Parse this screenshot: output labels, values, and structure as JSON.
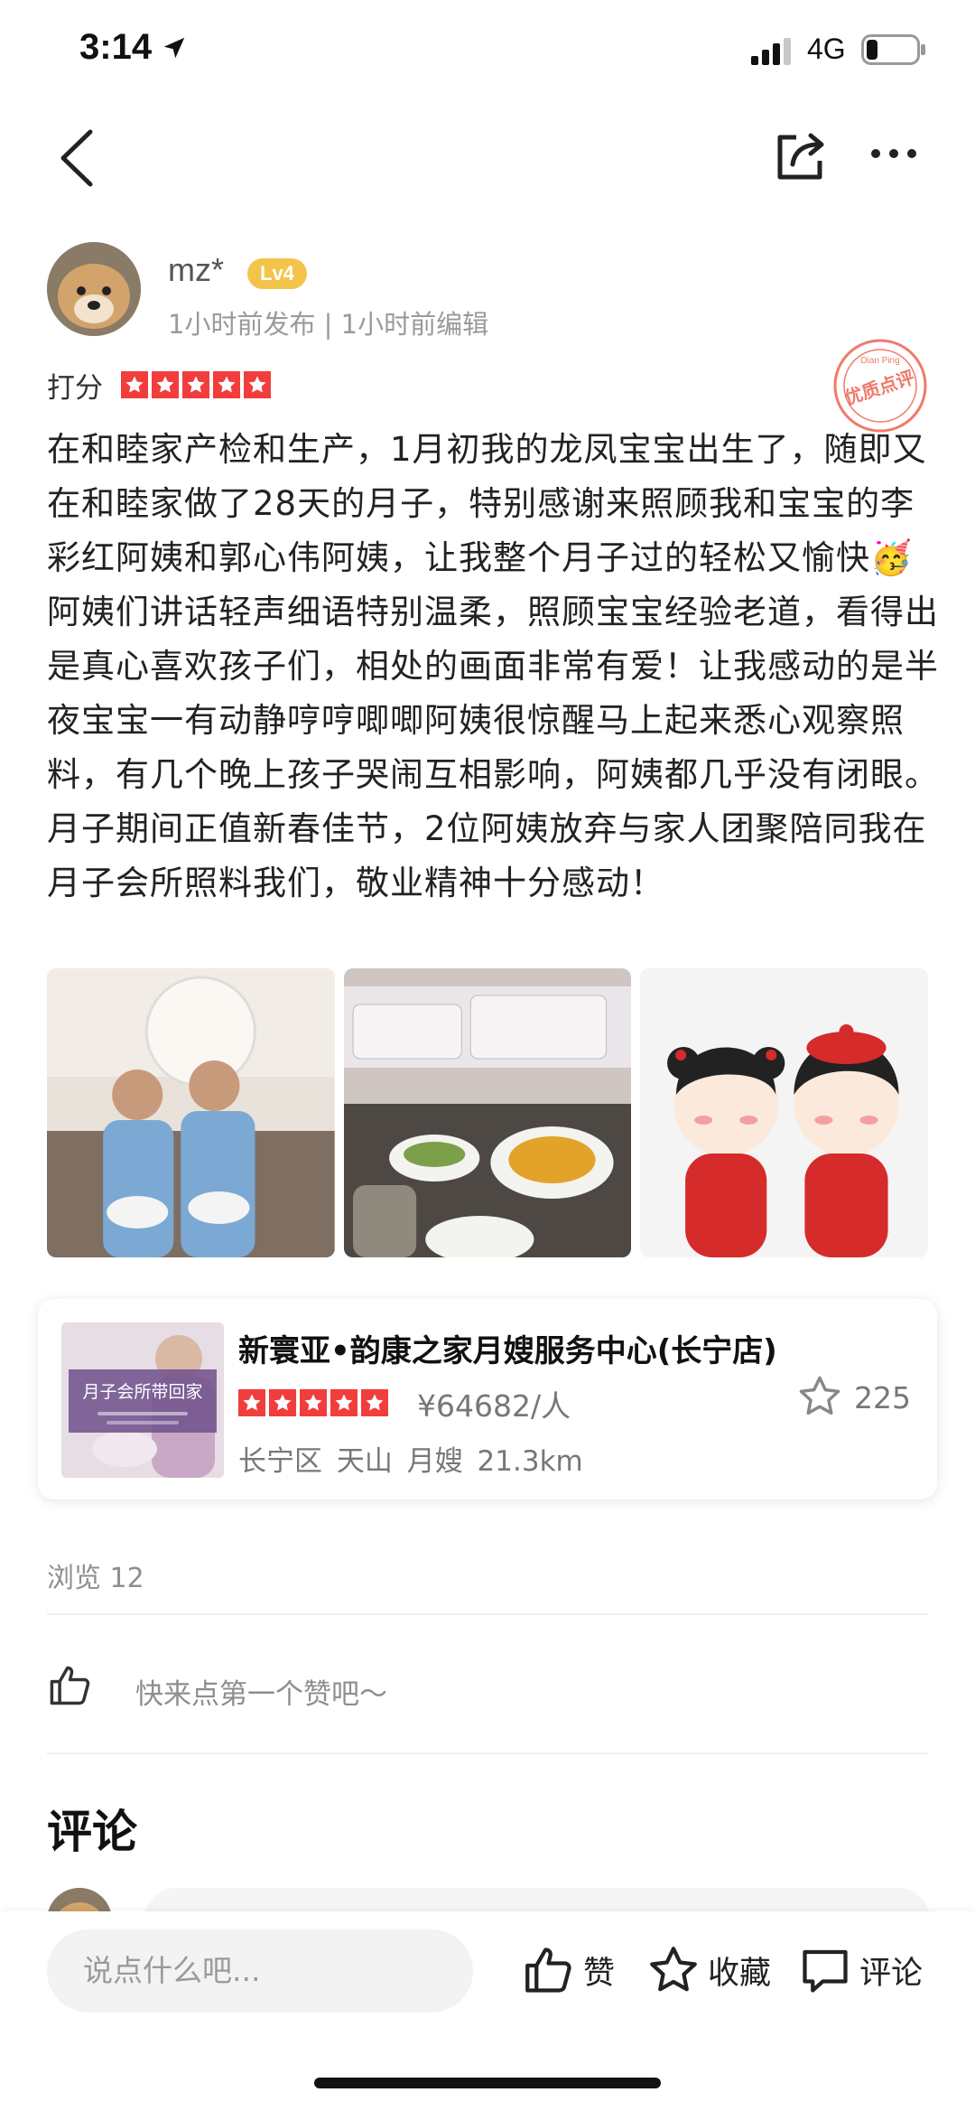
{
  "status_bar": {
    "time": "3:14",
    "network": "4G",
    "signal_bars": 3,
    "battery_level": 0.2
  },
  "author": {
    "name": "mz*",
    "level": "Lv4",
    "meta": "1小时前发布 | 1小时前编辑"
  },
  "review": {
    "rating_label": "打分",
    "rating": 5,
    "text": "在和睦家产检和生产，1月初我的龙凤宝宝出生了，随即又在和睦家做了28天的月子，特别感谢来照顾我和宝宝的李彩红阿姨和郭心伟阿姨，让我整个月子过的轻松又愉快🥳阿姨们讲话轻声细语特别温柔，照顾宝宝经验老道，看得出是真心喜欢孩子们，相处的画面非常有爱！让我感动的是半夜宝宝一有动静哼哼唧唧阿姨很惊醒马上起来悉心观察照料，有几个晚上孩子哭闹互相影响，阿姨都几乎没有闭眼。月子期间正值新春佳节，2位阿姨放弃与家人团聚陪同我在月子会所照料我们，敬业精神十分感动！",
    "quality_stamp": "优质点评",
    "quality_stamp_sub": "Dian Ping"
  },
  "shop": {
    "name": "新寰亚•韵康之家月嫂服务中心(长宁店)",
    "thumb_text": "月子会所带回家",
    "rating": 5,
    "price": "¥64682/人",
    "favorites": "225",
    "meta": "长宁区 天山 月嫂 21.3km"
  },
  "stats": {
    "views": "浏览 12",
    "like_prompt": "快来点第一个赞吧～"
  },
  "comments": {
    "title": "评论",
    "partial_placeholder": "说点什么吧"
  },
  "bottom_bar": {
    "input_placeholder": "说点什么吧...",
    "like_label": "赞",
    "favorite_label": "收藏",
    "comment_label": "评论"
  },
  "colors": {
    "accent_red": "#f23d3d",
    "level_badge": "#f4c44a",
    "muted_text": "#8e8e8e"
  }
}
